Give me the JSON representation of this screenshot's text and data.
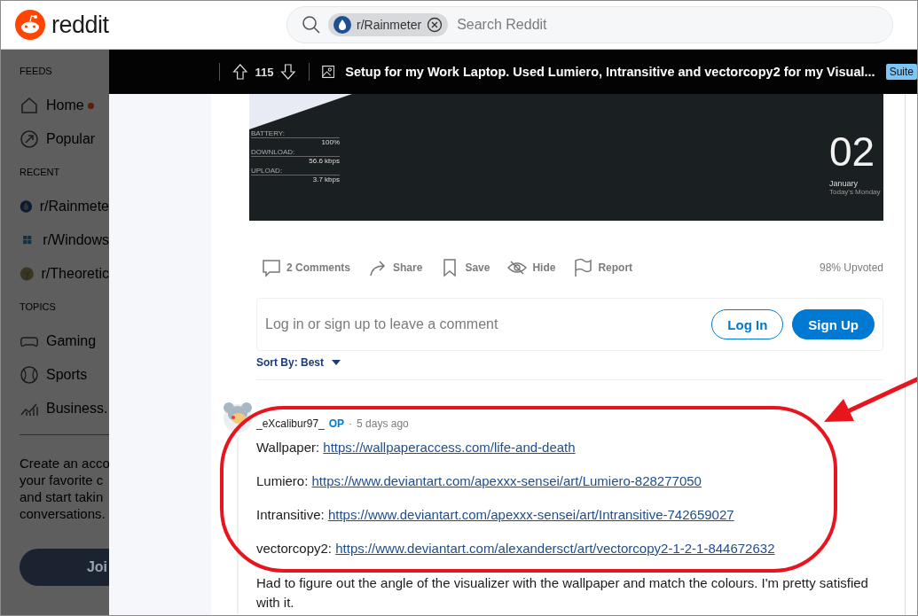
{
  "header": {
    "logo": "reddit",
    "search": {
      "chip": "r/Rainmeter",
      "placeholder": "Search Reddit"
    }
  },
  "sidebar": {
    "sections": [
      {
        "heading": "FEEDS",
        "items": [
          {
            "label": "Home",
            "notification": true
          },
          {
            "label": "Popular",
            "notification": false
          }
        ]
      },
      {
        "heading": "RECENT",
        "items": [
          {
            "label": "r/Rainmete",
            "notification": false
          },
          {
            "label": "r/Windows",
            "notification": false
          },
          {
            "label": "r/Theoretic",
            "notification": false
          }
        ]
      },
      {
        "heading": "TOPICS",
        "items": [
          {
            "label": "Gaming",
            "notification": false
          },
          {
            "label": "Sports",
            "notification": false
          },
          {
            "label": "Business.",
            "notification": false
          }
        ]
      }
    ],
    "promo_lines": [
      "Create an acco",
      "your favorite c",
      "and start takin",
      "conversations."
    ],
    "join_button": "Joi"
  },
  "post_bar": {
    "votes": "115",
    "title": "Setup for my Work Laptop. Used Lumiero, Intransitive and vectorcopy2 for my Visual...",
    "flair": "Suite"
  },
  "post_image": {
    "stats": [
      {
        "label": "BATTERY:",
        "value": "100%"
      },
      {
        "label": "DOWNLOAD:",
        "value": "56.6 kbps"
      },
      {
        "label": "UPLOAD:",
        "value": "3.7 kbps"
      }
    ],
    "day": "02",
    "month": "January",
    "weekday": "Today's Monday"
  },
  "actions": [
    {
      "label": "2 Comments"
    },
    {
      "label": "Share"
    },
    {
      "label": "Save"
    },
    {
      "label": "Hide"
    },
    {
      "label": "Report"
    }
  ],
  "upvoted": "98% Upvoted",
  "comment_prompt": {
    "text": "Log in or sign up to leave a comment",
    "login": "Log In",
    "signup": "Sign Up"
  },
  "sort": "Sort By: Best",
  "comment": {
    "author": "_eXcalibur97_",
    "op": "OP",
    "separator": "·",
    "time": "5 days ago",
    "links": [
      {
        "label": "Wallpaper:",
        "url": "https://wallpaperaccess.com/life-and-death"
      },
      {
        "label": "Lumiero:",
        "url": "https://www.deviantart.com/apexxx-sensei/art/Lumiero-828277050"
      },
      {
        "label": "Intransitive:",
        "url": "https://www.deviantart.com/apexxx-sensei/art/Intransitive-742659027"
      },
      {
        "label": "vectorcopy2:",
        "url": "https://www.deviantart.com/alexandersct/art/vectorcopy2-1-2-1-844672632"
      }
    ],
    "body": "Had to figure out the angle of the visualizer with the wallpaper and match the colours. I'm pretty satisfied with it."
  }
}
